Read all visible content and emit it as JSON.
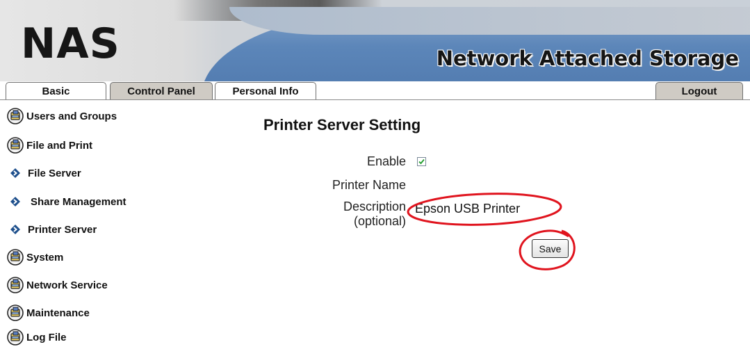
{
  "header": {
    "logo": "NAS",
    "subtitle": "Network Attached Storage"
  },
  "tabs": {
    "basic": "Basic",
    "control_panel": "Control Panel",
    "personal_info": "Personal Info",
    "logout": "Logout"
  },
  "sidebar": {
    "items": [
      {
        "label": "Users and Groups",
        "icon": "folder-globe-icon"
      },
      {
        "label": "File and Print",
        "icon": "folder-globe-icon"
      },
      {
        "label": "File Server",
        "icon": "bullet-arrow-icon"
      },
      {
        "label": "Share Management",
        "icon": "bullet-arrow-icon"
      },
      {
        "label": "Printer Server",
        "icon": "bullet-arrow-icon"
      },
      {
        "label": "System",
        "icon": "folder-globe-icon"
      },
      {
        "label": "Network Service",
        "icon": "folder-globe-icon"
      },
      {
        "label": "Maintenance",
        "icon": "folder-globe-icon"
      },
      {
        "label": "Log File",
        "icon": "folder-globe-icon"
      }
    ]
  },
  "main": {
    "title": "Printer Server Setting",
    "enable_label": "Enable",
    "enable_checked": true,
    "printer_name_label": "Printer Name",
    "description_label": "Description",
    "description_optional": "(optional)",
    "description_value": "Epson USB Printer",
    "save_label": "Save"
  },
  "colors": {
    "annotation": "#e0141e",
    "tab_active": "#ffffff",
    "tab_inactive": "#cfcbc4",
    "banner_blue": "#5c86b9",
    "bullet": "#1d4f8c"
  }
}
